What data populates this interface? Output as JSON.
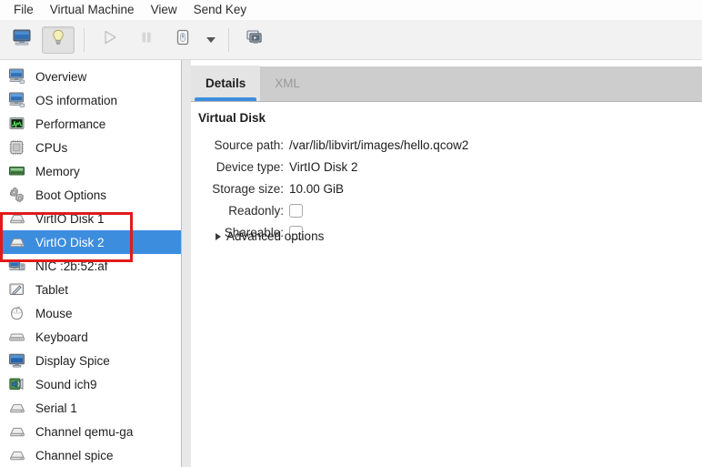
{
  "window": {
    "menubar": [
      {
        "label": "File",
        "name": "menu-file"
      },
      {
        "label": "Virtual Machine",
        "name": "menu-virtual-machine"
      },
      {
        "label": "View",
        "name": "menu-view"
      },
      {
        "label": "Send Key",
        "name": "menu-send-key"
      }
    ]
  },
  "toolbar": {
    "buttons": [
      {
        "icon": "console-monitor-icon",
        "name": "show-console-button",
        "state": "normal"
      },
      {
        "icon": "lightbulb-icon",
        "name": "show-details-button",
        "state": "pressed"
      },
      {
        "icon": "play-triangle-icon",
        "name": "run-button",
        "state": "disabled"
      },
      {
        "icon": "pause-bars-icon",
        "name": "pause-button",
        "state": "disabled"
      },
      {
        "icon": "power-shutdown-icon",
        "name": "shutdown-button",
        "state": "normal"
      },
      {
        "icon": "chevron-down-icon",
        "name": "shutdown-menu-button",
        "state": "normal"
      },
      {
        "icon": "snapshots-screens-icon",
        "name": "manage-snapshots-button",
        "state": "normal"
      }
    ]
  },
  "sidebar": {
    "items": [
      {
        "label": "Overview",
        "icon": "computer-monitor-icon",
        "selected": false
      },
      {
        "label": "OS information",
        "icon": "computer-monitor-icon",
        "selected": false
      },
      {
        "label": "Performance",
        "icon": "performance-graph-icon",
        "selected": false
      },
      {
        "label": "CPUs",
        "icon": "cpu-chip-icon",
        "selected": false
      },
      {
        "label": "Memory",
        "icon": "memory-stick-icon",
        "selected": false
      },
      {
        "label": "Boot Options",
        "icon": "gears-icon",
        "selected": false
      },
      {
        "label": "VirtIO Disk 1",
        "icon": "harddisk-icon",
        "selected": false
      },
      {
        "label": "VirtIO Disk 2",
        "icon": "harddisk-icon",
        "selected": true
      },
      {
        "label": "NIC :2b:52:af",
        "icon": "network-card-icon",
        "selected": false
      },
      {
        "label": "Tablet",
        "icon": "tablet-pen-icon",
        "selected": false
      },
      {
        "label": "Mouse",
        "icon": "mouse-icon",
        "selected": false
      },
      {
        "label": "Keyboard",
        "icon": "keyboard-icon",
        "selected": false
      },
      {
        "label": "Display Spice",
        "icon": "display-monitor-icon",
        "selected": false
      },
      {
        "label": "Sound ich9",
        "icon": "sound-speaker-icon",
        "selected": false
      },
      {
        "label": "Serial 1",
        "icon": "serial-port-icon",
        "selected": false
      },
      {
        "label": "Channel qemu-ga",
        "icon": "serial-port-icon",
        "selected": false
      },
      {
        "label": "Channel spice",
        "icon": "serial-port-icon",
        "selected": false
      }
    ]
  },
  "content": {
    "tabs": [
      {
        "label": "Details",
        "active": true
      },
      {
        "label": "XML",
        "active": false
      }
    ],
    "section_title": "Virtual Disk",
    "fields": [
      {
        "label": "Source path:",
        "value": "/var/lib/libvirt/images/hello.qcow2"
      },
      {
        "label": "Device type:",
        "value": "VirtIO Disk 2"
      },
      {
        "label": "Storage size:",
        "value": "10.00 GiB"
      }
    ],
    "checkboxes": [
      {
        "label": "Readonly:",
        "checked": false
      },
      {
        "label": "Shareable:",
        "checked": false
      }
    ],
    "advanced_options_label": "Advanced options"
  },
  "annotation": {
    "color": "#e01b1b",
    "highlights_items": [
      "VirtIO Disk 1",
      "VirtIO Disk 2"
    ]
  },
  "colors": {
    "selection_blue": "#3d8ddf",
    "annotation_red": "#e01b1b",
    "tabbar_gray": "#cdcdcd"
  }
}
